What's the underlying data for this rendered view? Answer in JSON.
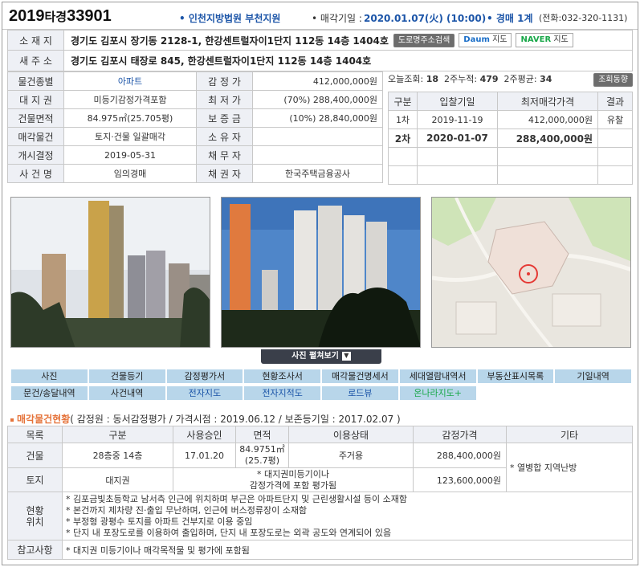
{
  "header": {
    "case_year": "2019",
    "case_type": "타경",
    "case_num": "33901",
    "court": "인천지방법원 부천지원",
    "sale_date_label": "매각기일 :",
    "sale_date": "2020.01.07(火) (10:00)",
    "auction_type": "경매 1계",
    "phone": "(전화:032-320-1131)",
    "accent_color": "#1c55a8"
  },
  "address": {
    "lot_label": "소 재 지",
    "lot_value": "경기도 김포시 장기동 2128-1, 한강센트럴자이1단지 112동 14층 1404호",
    "road_search_btn": "도로명주소검색",
    "road_label": "새 주 소",
    "road_value": "경기도 김포시 태장로 845, 한강센트럴자이1단지 112동 14층 1404호",
    "daum_map_btn_brand": "Daum",
    "daum_map_btn": "지도",
    "naver_map_btn_brand": "NAVER",
    "naver_map_btn": "지도"
  },
  "info": {
    "type_label": "물건종별",
    "type_value": "아파트",
    "appraisal_label": "감 정 가",
    "appraisal_value": "412,000,000원",
    "land_right_label": "대 지 권",
    "land_right_value": "미등기감정가격포함",
    "min_price_label": "최 저 가",
    "min_price_value": "(70%) 288,400,000원",
    "area_label": "건물면적",
    "area_value": "84.975㎡(25.705평)",
    "deposit_label": "보 증 금",
    "deposit_value": "(10%) 28,840,000원",
    "sale_obj_label": "매각물건",
    "sale_obj_value": "토지·건물 일괄매각",
    "owner_label": "소 유 자",
    "owner_value": "",
    "start_label": "개시결정",
    "start_value": "2019-05-31",
    "debtor_label": "채 무 자",
    "debtor_value": "",
    "case_name_label": "사 건 명",
    "case_name_value": "임의경매",
    "creditor_label": "채 권 자",
    "creditor_value": "한국주택금융공사"
  },
  "stats": {
    "today_label": "오늘조회:",
    "today": "18",
    "two_week_label": "2주누적:",
    "two_week": "479",
    "avg_label": "2주평균:",
    "avg": "34",
    "btn": "조회동향"
  },
  "bids": {
    "headers": [
      "구분",
      "입찰기일",
      "최저매각가격",
      "결과"
    ],
    "rows": [
      {
        "round": "1차",
        "date": "2019-11-19",
        "price": "412,000,000원",
        "result": "유찰"
      },
      {
        "round": "2차",
        "date": "2020-01-07",
        "price": "288,400,000원",
        "result": ""
      }
    ]
  },
  "photos": {
    "toggle_btn": "사진 펼쳐보기"
  },
  "tabs": [
    {
      "label": "사진",
      "style": ""
    },
    {
      "label": "건물등기",
      "style": ""
    },
    {
      "label": "감정평가서",
      "style": ""
    },
    {
      "label": "현황조사서",
      "style": ""
    },
    {
      "label": "매각물건명세서",
      "style": ""
    },
    {
      "label": "세대열람내역서",
      "style": ""
    },
    {
      "label": "부동산표시목록",
      "style": ""
    },
    {
      "label": "기일내역",
      "style": ""
    },
    {
      "label": "문건/송달내역",
      "style": ""
    },
    {
      "label": "사건내역",
      "style": ""
    },
    {
      "label": "전자지도",
      "style": "blue"
    },
    {
      "label": "전자지적도",
      "style": "blue"
    },
    {
      "label": "로드뷰",
      "style": "blue"
    },
    {
      "label": "온나라지도+",
      "style": "green"
    }
  ],
  "status": {
    "title": "매각물건현황",
    "meta": "( 감정원 : 동서감정평가 / 가격시점 : 2019.06.12 / 보존등기일 : 2017.02.07 )",
    "headers": [
      "목록",
      "구분",
      "사용승인",
      "면적",
      "이용상태",
      "감정가격",
      "기타"
    ],
    "building": {
      "label": "건물",
      "kind": "28층중 14층",
      "approved": "17.01.20",
      "area1": "84.9751㎡",
      "area2": "(25.7평)",
      "use": "주거용",
      "price": "288,400,000원"
    },
    "land": {
      "label": "토지",
      "kind": "대지권",
      "note1": "* 대지권미등기이나",
      "note2": "감정가격에 포함 평가됨",
      "price": "123,600,000원"
    },
    "other": "* 열병합 지역난방",
    "location_label1": "현황",
    "location_label2": "위치",
    "location_lines": [
      "* 김포금빛초등학교 남서측 인근에 위치하며 부근은 아파트단지 및 근린생활시설 등이 소재함",
      "* 본건까지 제차량 진·출입 무난하며, 인근에 버스정류장이 소재함",
      "* 부정형 광평수 토지를 아파트 건부지로 이용 중임",
      "* 단지 내 포장도로를 이용하여 출입하며, 단지 내 포장도로는 외곽 공도와 연계되어 있음"
    ],
    "ref_label": "참고사항",
    "ref_value": "* 대지권 미등기이나 매각목적물 및 평가에 포함됨"
  }
}
